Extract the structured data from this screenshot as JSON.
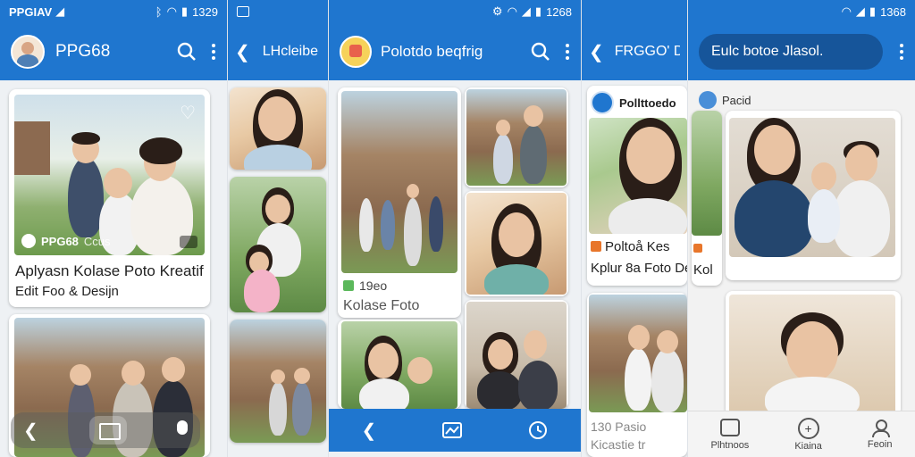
{
  "colors": {
    "primary": "#1f76cf",
    "background": "#eef1f4",
    "card": "#ffffff"
  },
  "p1": {
    "status_left": "PPGIAV",
    "status_right": "1329",
    "app_title": "PPG68",
    "card1_badge": "PPG68",
    "card1_badge_extra": "Ccus",
    "card1_title": "Aplyasn Kolase Poto Kreatif",
    "card1_subtitle": "Edit Foo & Desijn"
  },
  "p2": {
    "title": "LHcleibe"
  },
  "p3": {
    "status_right": "1268",
    "app_title": "Polotdo beqfrig",
    "caption_count": "19eo",
    "caption_text": "Kolase Foto"
  },
  "p4": {
    "title": "FRGGO' DI",
    "brand": "Pollttoedo",
    "heading_line1": "Poltoå Kes",
    "heading_line2": "Kplur 8a Foto De",
    "count_line1": "130 Pasio",
    "count_line2": "Kicastie tr"
  },
  "p5": {
    "status_right": "1368",
    "search_text": "Eulc botoe Jlasol.",
    "section_title": "Pacid",
    "side_label": "Kol",
    "nav": [
      "Plhtnoos",
      "Kiaina",
      "Feoin"
    ]
  }
}
